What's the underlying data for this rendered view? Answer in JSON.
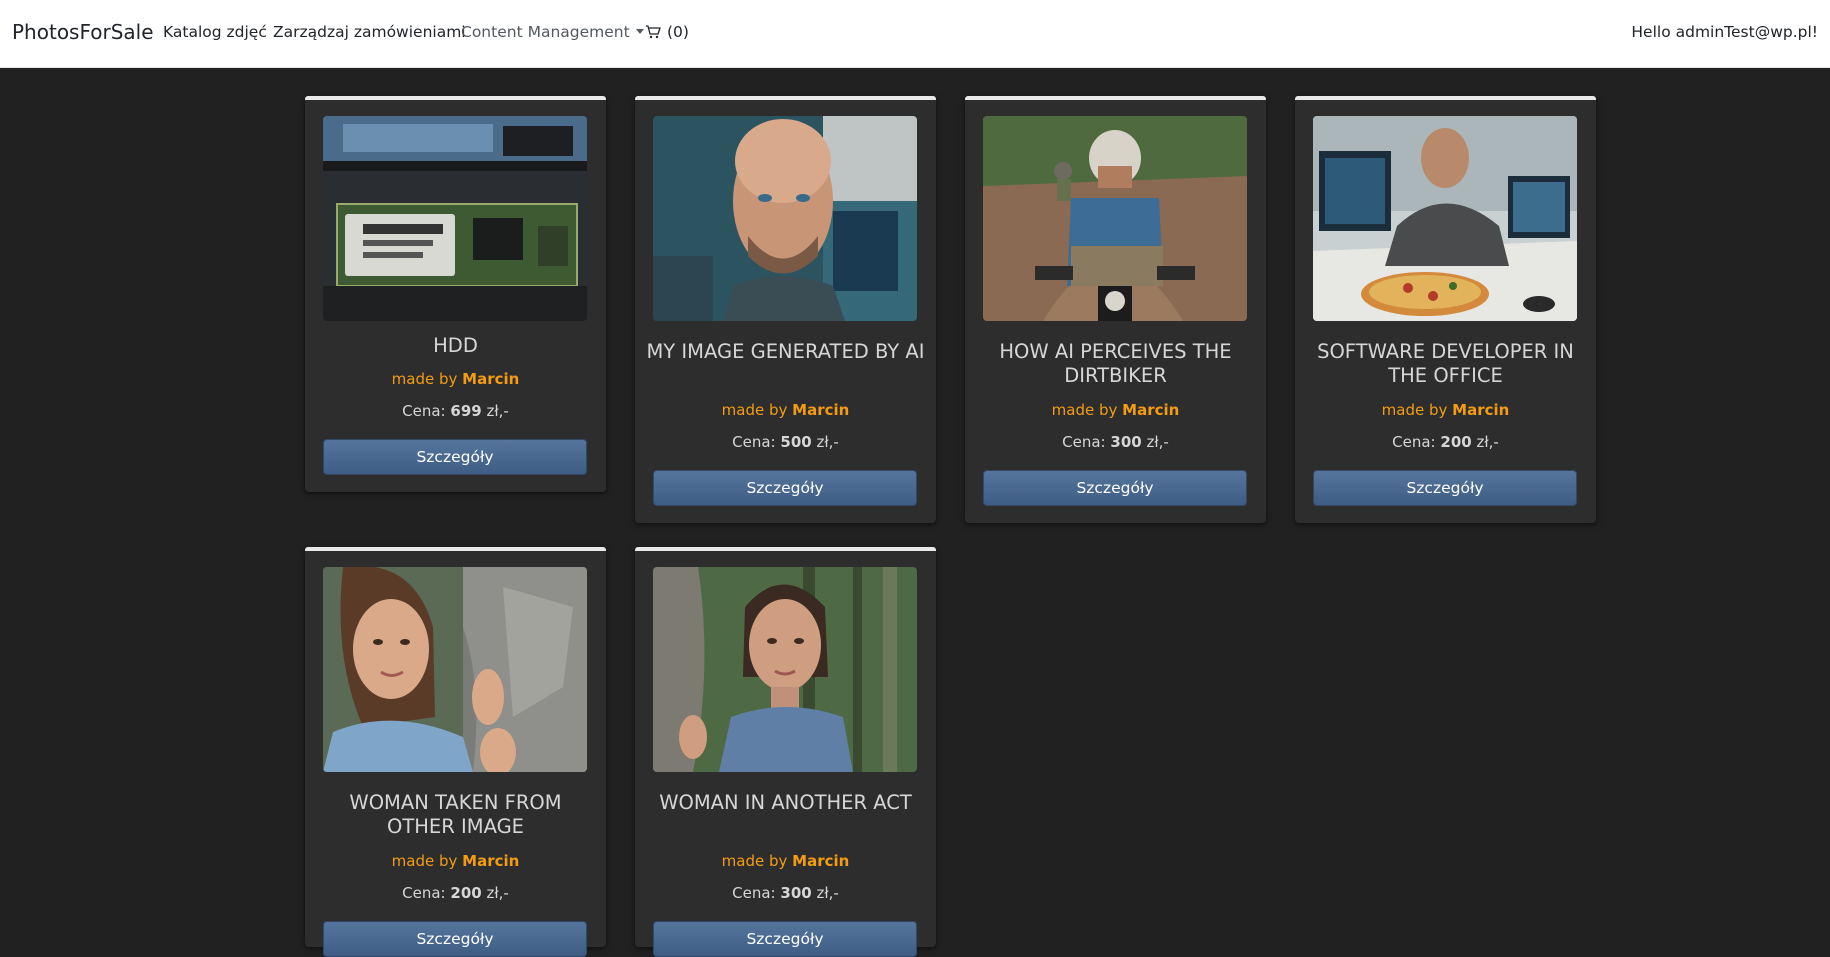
{
  "navbar": {
    "brand": "PhotosForSale",
    "links": [
      "Katalog zdjęć",
      "Zarządzaj zamówieniami"
    ],
    "dropdown_label": "Content Management",
    "cart_count": "(0)",
    "greeting": "Hello adminTest@wp.pl!"
  },
  "labels": {
    "made_by": "made by",
    "price_prefix": "Cena:",
    "currency": "zł,-",
    "details_button": "Szczegóły"
  },
  "photos": [
    {
      "title": "HDD",
      "author": "Marcin",
      "price": "699"
    },
    {
      "title": "MY IMAGE GENERATED BY AI",
      "author": "Marcin",
      "price": "500"
    },
    {
      "title": "HOW AI PERCEIVES THE DIRTBIKER",
      "author": "Marcin",
      "price": "300"
    },
    {
      "title": "SOFTWARE DEVELOPER IN THE OFFICE",
      "author": "Marcin",
      "price": "200"
    },
    {
      "title": "WOMAN TAKEN FROM OTHER IMAGE",
      "author": "Marcin",
      "price": "200"
    },
    {
      "title": "WOMAN IN ANOTHER ACT",
      "author": "Marcin",
      "price": "300"
    }
  ]
}
